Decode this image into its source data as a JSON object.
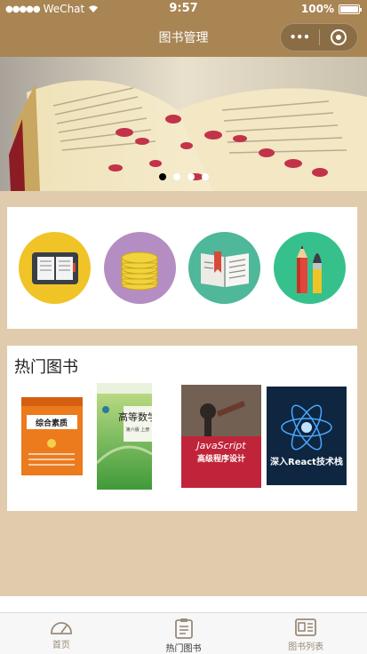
{
  "status_bar": {
    "carrier": "WeChat",
    "time": "9:57",
    "battery": "100%"
  },
  "nav": {
    "title": "图书管理",
    "more_glyph": "•••"
  },
  "banner": {
    "slides": 4,
    "active_index": 0
  },
  "categories": [
    {
      "icon": "tablet-book-icon",
      "color": "#f0c426"
    },
    {
      "icon": "coins-icon",
      "color": "#b48ec2"
    },
    {
      "icon": "bookmark-book-icon",
      "color": "#4fb79a"
    },
    {
      "icon": "pencil-brush-icon",
      "color": "#36c18c"
    }
  ],
  "hot": {
    "title": "热门图书",
    "books": [
      {
        "title": "综合素质",
        "color": "#e8791e"
      },
      {
        "title": "高等数学",
        "subtitle": "第六版 上册",
        "color": "#7fc04a"
      },
      {
        "title": "JavaScript",
        "subtitle": "高级程序设计",
        "color": "#c0243a"
      },
      {
        "title": "深入React技术栈",
        "color": "#0f2742"
      }
    ]
  },
  "tabs": [
    {
      "label": "首页",
      "icon": "home-icon",
      "active": false
    },
    {
      "label": "热门图书",
      "icon": "clipboard-icon",
      "active": true
    },
    {
      "label": "图书列表",
      "icon": "book-list-icon",
      "active": false
    }
  ],
  "colors": {
    "nav_bg": "#a98554",
    "page_bg": "#e1cbad"
  }
}
